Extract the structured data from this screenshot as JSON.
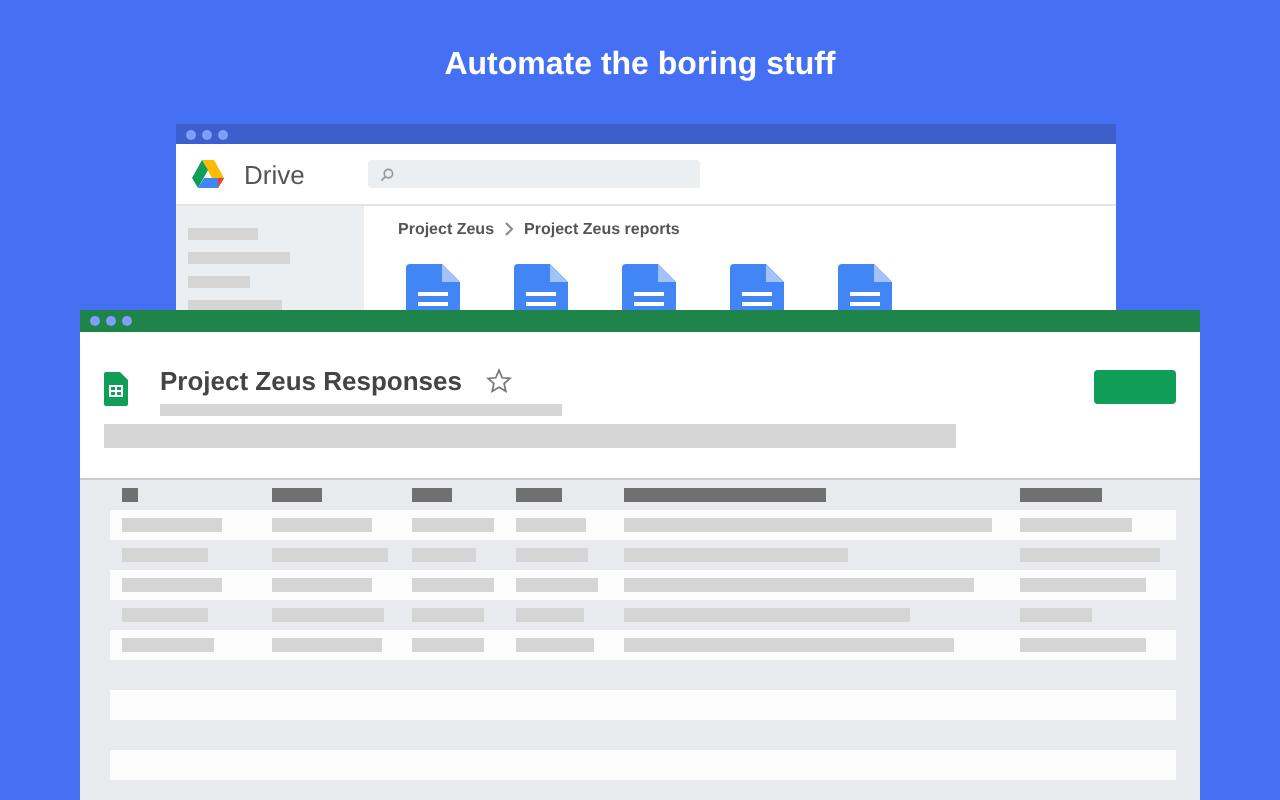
{
  "headline": "Automate the boring stuff",
  "drive_window": {
    "app_name": "Drive",
    "breadcrumb": [
      "Project Zeus",
      "Project Zeus reports"
    ],
    "files": [
      {
        "kind": "doc"
      },
      {
        "kind": "doc"
      },
      {
        "kind": "doc"
      },
      {
        "kind": "doc"
      },
      {
        "kind": "doc"
      }
    ]
  },
  "sheets_window": {
    "title": "Project Zeus Responses",
    "starred": false
  }
}
